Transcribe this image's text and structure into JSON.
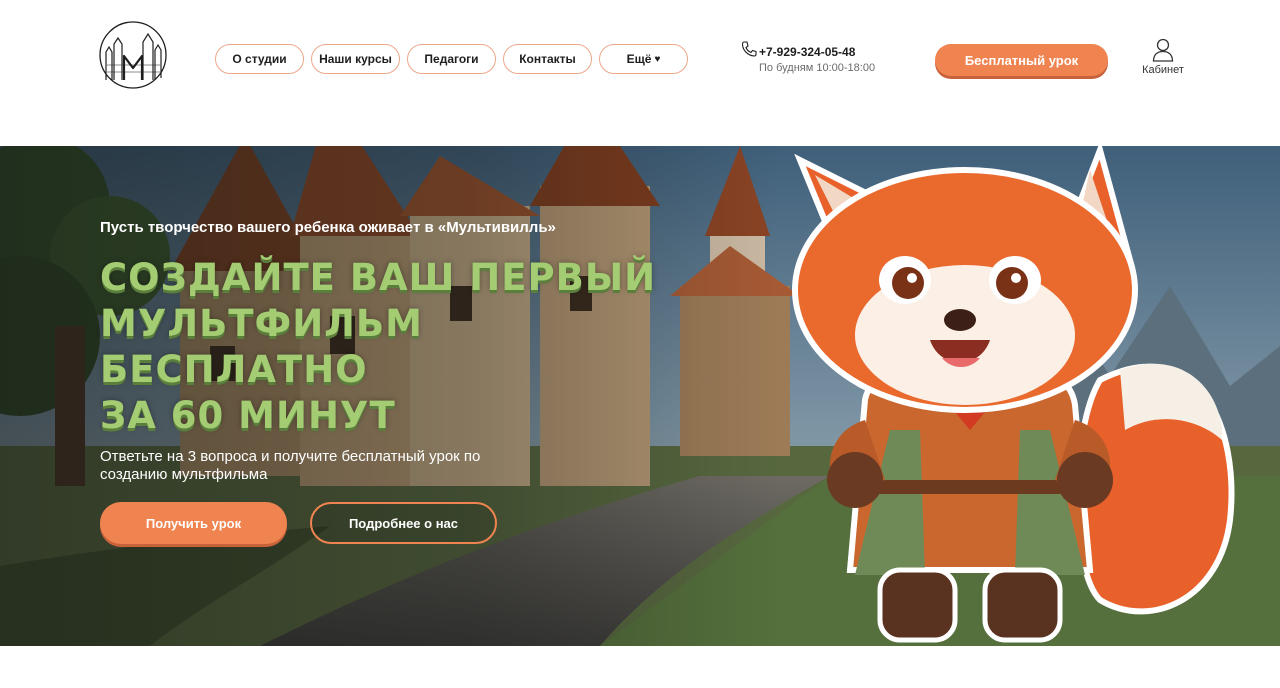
{
  "header": {
    "logo_letter": "М",
    "nav": [
      {
        "label": "О студии",
        "width": 89
      },
      {
        "label": "Наши курсы",
        "width": 89
      },
      {
        "label": "Педагоги",
        "width": 89
      },
      {
        "label": "Контакты",
        "width": 89
      },
      {
        "label": "Ещё",
        "width": 89
      }
    ],
    "phone": "+7-929-324-05-48",
    "hours": "По будням 10:00-18:00",
    "cta": "Бесплатный урок",
    "cabinet": "Кабинет"
  },
  "hero": {
    "kicker": "Пусть творчество вашего ребенка оживает в «Мультивилль»",
    "title_lines": [
      "Создайте ваш первый",
      "мультфильм бесплатно",
      "за 60 минут"
    ],
    "subtitle": "Ответьте на 3 вопроса и получите бесплатный урок по созданию мультфильма",
    "primary_button": "Получить урок",
    "secondary_button": "Подробнее о нас"
  },
  "colors": {
    "accent": "#f08451",
    "title_green": "#a4cc72",
    "nav_border": "#eda88a"
  },
  "icons": {
    "logo": "castle-logo-icon",
    "phone": "phone-icon",
    "user": "user-icon",
    "heart": "heart-icon"
  }
}
